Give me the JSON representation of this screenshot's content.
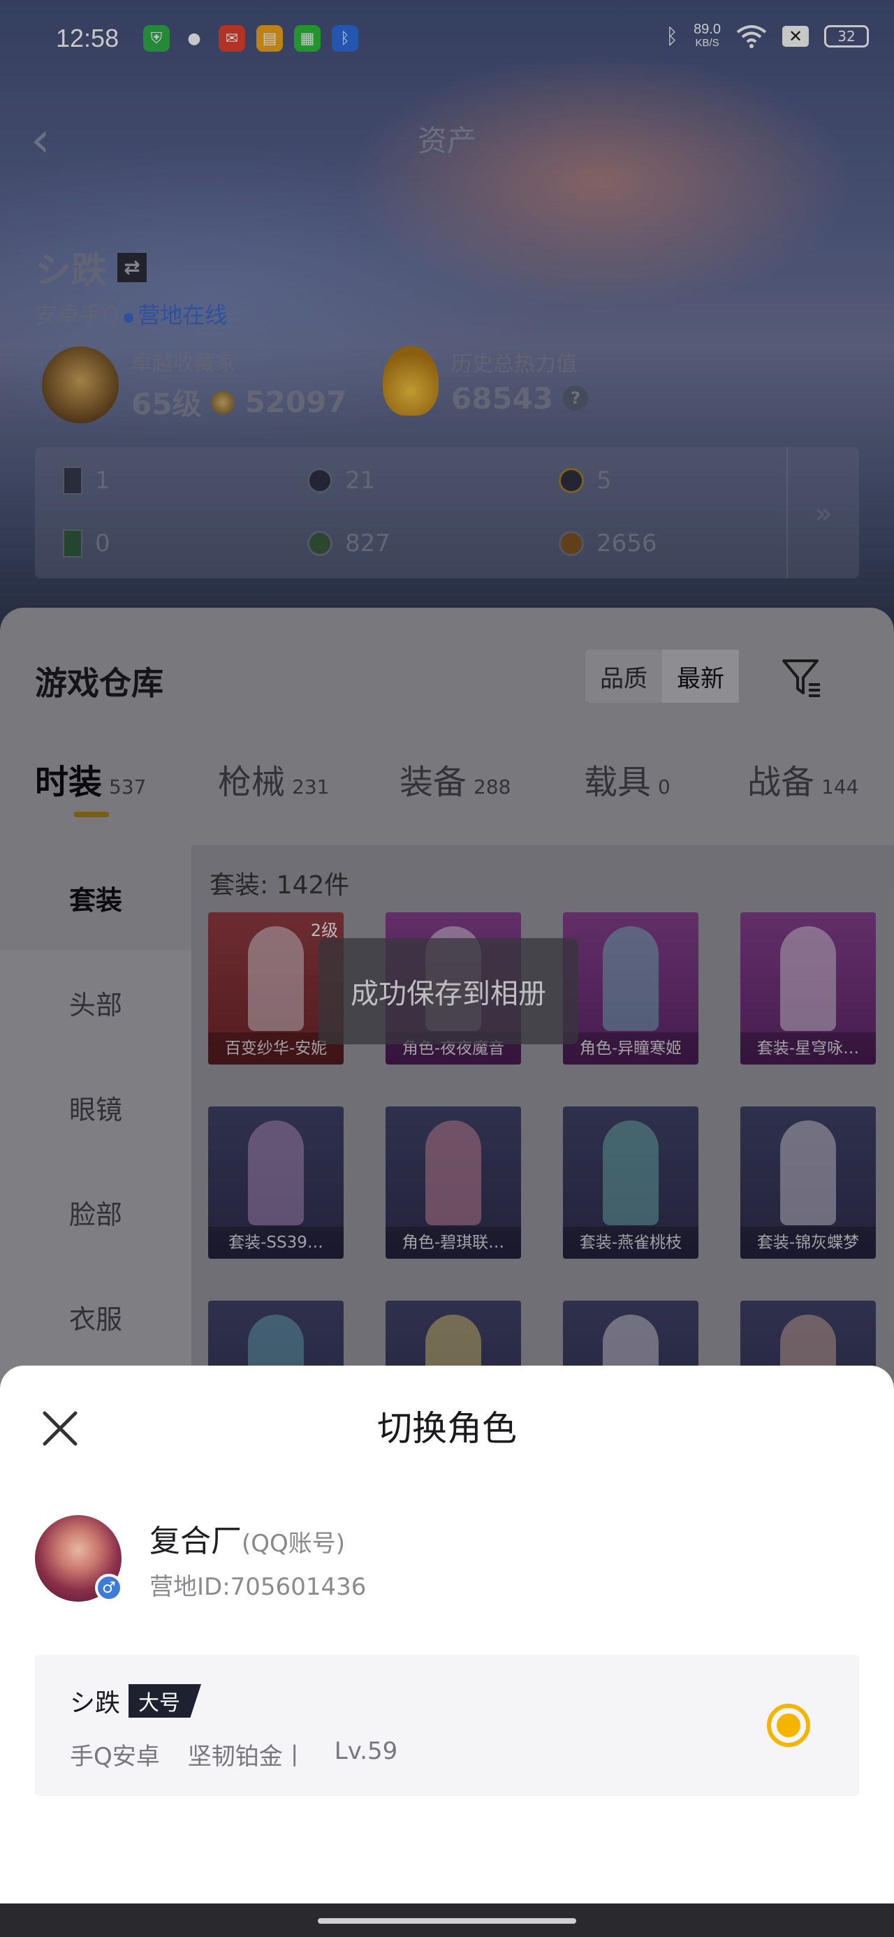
{
  "status_bar": {
    "time": "12:58",
    "net_speed_value": "89.0",
    "net_speed_unit": "KB/S",
    "battery": "32",
    "apps": [
      {
        "icon": "shield-app-icon",
        "color": "#2fb14a"
      },
      {
        "icon": "wechat-icon",
        "color": "#ffffff"
      },
      {
        "icon": "mail-app-icon",
        "color": "#e4412e"
      },
      {
        "icon": "book-app-icon",
        "color": "#f2a71c"
      },
      {
        "icon": "grid-app-icon",
        "color": "#2fbf3c"
      },
      {
        "icon": "bluetooth-app-icon",
        "color": "#2f6fe0"
      }
    ]
  },
  "header": {
    "back": "‹",
    "title": "资产"
  },
  "player": {
    "name": "シ跌",
    "swap": "⇄",
    "platform": "安卓手Q",
    "status": "营地在线"
  },
  "stats": {
    "collector_label": "卓越收藏家",
    "collector_level": "65级",
    "collector_points": "52097",
    "heat_label": "历史总热力值",
    "heat_value": "68543",
    "help": "?"
  },
  "resources": {
    "row1": [
      "1",
      "21",
      "5"
    ],
    "row2": [
      "0",
      "827",
      "2656"
    ],
    "more": "»"
  },
  "warehouse": {
    "title": "游戏仓库",
    "sort_options": [
      "品质",
      "最新"
    ],
    "tabs": [
      {
        "label": "时装",
        "count": "537"
      },
      {
        "label": "枪械",
        "count": "231"
      },
      {
        "label": "装备",
        "count": "288"
      },
      {
        "label": "载具",
        "count": "0"
      },
      {
        "label": "战备",
        "count": "144"
      }
    ],
    "categories": [
      "套装",
      "头部",
      "眼镜",
      "脸部",
      "衣服"
    ],
    "count_label": "套装: 142件",
    "items": [
      {
        "caption": "百变纱华-安妮",
        "level": "2级"
      },
      {
        "caption": "角色-夜夜魔音"
      },
      {
        "caption": "角色-异瞳寒姬"
      },
      {
        "caption": "套装-星穹咏…"
      },
      {
        "caption": "套装-SS39…"
      },
      {
        "caption": "角色-碧琪联…"
      },
      {
        "caption": "套装-燕雀桃枝"
      },
      {
        "caption": "套装-锦灰蝶梦"
      }
    ]
  },
  "toast": "成功保存到相册",
  "modal": {
    "title": "切换角色",
    "account_name": "复合厂",
    "account_type": "(QQ账号)",
    "account_id": "营地ID:705601436",
    "gender": "♂",
    "role": {
      "name": "シ跌",
      "tag": "大号",
      "platform": "手Q安卓",
      "rank": "坚韧铂金丨",
      "level": "Lv.59"
    }
  }
}
